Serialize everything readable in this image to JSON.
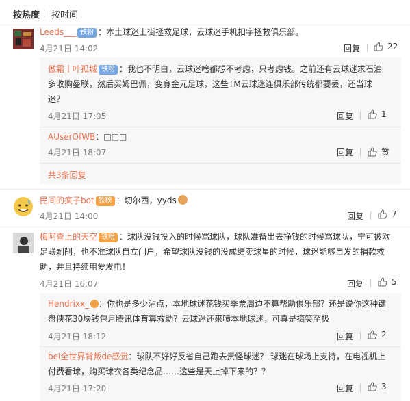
{
  "sort": {
    "hot": "按热度",
    "time": "按时间"
  },
  "comments": [
    {
      "user": "Leeds___",
      "badge": "铁粉",
      "text": "：本土球迷上街拯救足球，云球迷手机扣字拯救俱乐部。",
      "time": "4月21日 14:02",
      "reply_label": "回复",
      "likes": "22",
      "replies": [
        {
          "user": "傲霜丨叶孤城",
          "badge": "铁粉",
          "text_line1": "：我也不明白，云球迷啥都想不考虑，只考虑钱。之前还有云球迷求石油",
          "text_line2": "多收购曼联，然后买姆巴佩，变身金元足球，这些TM云球迷连俱乐部传统都要丢，还当球",
          "text_line3": "迷？",
          "time": "4月21日 17:05",
          "reply_label": "回复",
          "likes": "1"
        },
        {
          "user": "AUserOfWB",
          "text": "：□□□",
          "time": "4月21日 18:07",
          "reply_label": "回复",
          "likes": "赞"
        }
      ],
      "more": "共3条回复"
    },
    {
      "user": "民间的疯子bot",
      "badge": "铁粉",
      "text": "：切尔西，yyds",
      "time": "4月21日 14:00",
      "reply_label": "回复",
      "likes": "7"
    },
    {
      "user": "梅阿查上的天空",
      "badge": "铁粉",
      "text_line1": "：球队没钱投入的时候骂球队，球队准备出去挣钱的时候骂球队，宁可被欧",
      "text_line2": "足联剥削，也不准球队自立门户，希望球队没钱的没成绩卖球星的时候，球迷能够自发的捐款救",
      "text_line3": "助，并且持续用爱发电！",
      "time": "4月21日 16:07",
      "reply_label": "回复",
      "likes": "5",
      "replies": [
        {
          "user": "Hendrixx_",
          "text_line1": "：你也是多少沾点，本地球迷花钱买季票周边不算帮助俱乐部？还是说你这种键",
          "text_line2": "盘侠花30块钱包月腾讯体育算救助？云球迷还来喷本地球迷，可真是搞笑至极",
          "time": "4月21日 18:12",
          "reply_label": "回复",
          "likes": "2"
        },
        {
          "user": "bei全世界背叛de感觉",
          "text_line1": "：球队不好好反省自己跑去责怪球迷？ 球迷在球场上支持，在电视机上",
          "text_line2": "付费看球，购买球衣各类纪念品……这些是天上掉下来的？？",
          "time": "4月21日 17:20",
          "reply_label": "回复",
          "likes": "3"
        }
      ]
    }
  ],
  "colors": {
    "username": "#eb7350",
    "badge": "#77a8e6",
    "subbox": "#f7f7f7",
    "time": "#808080"
  }
}
